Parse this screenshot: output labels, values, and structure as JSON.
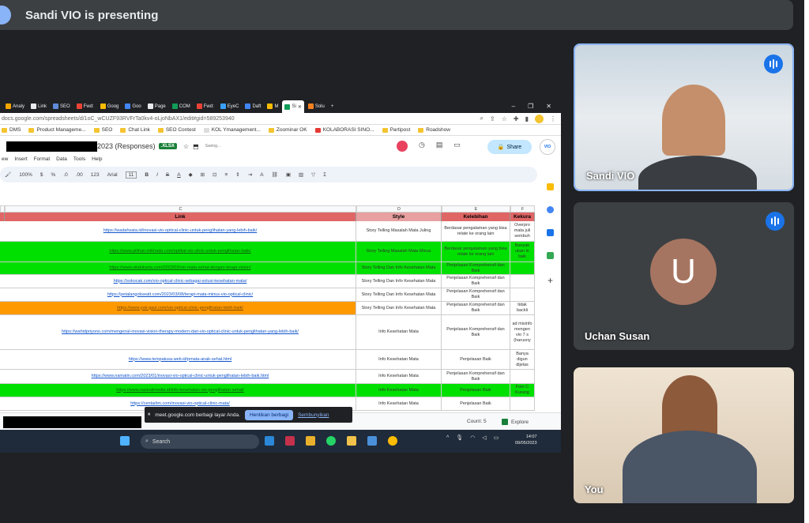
{
  "meet": {
    "presenter_text": "Sandi VIO is presenting",
    "participants": [
      {
        "name": "Sandi VIO",
        "speaking": true
      },
      {
        "name": "Uchan Susan",
        "initial": "U",
        "avatar_color": "#a67561",
        "speaking": true
      },
      {
        "name": "You"
      }
    ]
  },
  "browser": {
    "tabs": [
      "Analy",
      "Link",
      "SEO",
      "Fwd:",
      "Goog",
      "Goo",
      "Page",
      "COM",
      "Fwd:",
      "EyeC",
      "Daft",
      "M",
      "Si",
      "Solu"
    ],
    "url": "docs.google.com/spreadsheets/d/1oC_wCUZF93RVFrTa0kv4-oLjoNbAX1/edit#gid=589253940",
    "bookmarks": [
      "DMS",
      "Product Manageme...",
      "SEO",
      "Chat Link",
      "SEO Contest",
      "KOL Ymanagement...",
      "Zoominar OK",
      "KOLABORASI SINO...",
      "Partipost",
      "Roadshow"
    ]
  },
  "sheet": {
    "title_suffix": "2023 (Responses)",
    "badge": ".XLSX",
    "saving": "Saving...",
    "share_label": "Share",
    "vio": "VIO",
    "menus": [
      "Insert",
      "Format",
      "Data",
      "Tools",
      "Help"
    ],
    "toolbar": {
      "zoom": "100%",
      "currency": "$",
      "percent": "%",
      "dec1": ".0",
      "dec2": ".00",
      "fmt": "123",
      "font": "Arial",
      "size": "11"
    },
    "columns": [
      "C",
      "D",
      "E",
      "F"
    ],
    "headers": [
      "Link",
      "Style",
      "Kelebihan",
      "Kekura"
    ],
    "rows": [
      {
        "link": "https://wadahsata.id/inovasi-vio-optical-clinic-untuk-penglihatan-yang-lebih-baik/",
        "style": "Story Telling Masalah Mata Juling",
        "kelebihan": "Berdasar pengalaman yang bisa relate ke orang lain",
        "kekurangan": "Overpro mata juli sembuh"
      },
      {
        "link": "https://www.pilihan.mikhada.com/optikal-vio-clinic-untuk-penglihatan-baik/",
        "style": "Story Telling Masalah Mata Minus",
        "kelebihan": "Berdasar pengalaman yang bisa relate ke orang lain",
        "kekurangan": "Banyak ukan in baik"
      },
      {
        "link": "https://www.vitalokarta.com/2023/03/vio-mata-sehat-dengan-terapi-vision/",
        "style": "Story Telling Dan Info Kesehatan Mata",
        "kelebihan": "Penjelasan Komprehensif dan Baik",
        "kekurangan": ""
      },
      {
        "link": "https://sokocak.com/vio-optical-clinic-sebagai-solusi-kesehatan-mata/",
        "style": "Story Telling Dan Info Kesehatan Mata",
        "kelebihan": "Penjelasan Komprehensif dan Baik",
        "kekurangan": ""
      },
      {
        "link": "https://petalangokseatt.com/2023/03/08/terapi-mata-minus-vio-optical-clinic/",
        "style": "Story Telling Dan Info Kesehatan Mata",
        "kelebihan": "Penjelasan Komprehensif dan Baik",
        "kekurangan": ""
      },
      {
        "link": "https://www.yuk-gaul.com/vio-optical-clinic-penglihatan-lebih-baik/",
        "style": "Story Telling Dan Info Kesehatan Mata",
        "kelebihan": "Penjelasan Komprehensif dan Baik",
        "kekurangan": "tidak backli"
      },
      {
        "link": "https://wahidpriyono.com/mengenal-inovasi-vision-therapy-modern-dari-vio-optical-clinic-untuk-penglihatan-yang-lebih-baik/",
        "style": "Info Kesehatan Mata",
        "kelebihan": "Penjelasan Komprehensif dan Baik",
        "kekurangan": "ad misinfo mengen vio 7 s (harusny"
      },
      {
        "link": "https://www.tempatusa.web.id/pmata-anak-sehat.html",
        "style": "Info Kesehatan Mata",
        "kelebihan": "Penjelasan Baik",
        "kekurangan": "Banya digun dijelas"
      },
      {
        "link": "https://www.namatin.com/2023/01/inovasi-vio-optical-clinic-untuk-penglihatan-lebih-baik.html",
        "style": "Info Kesehatan Mata",
        "kelebihan": "Penjelasan Komprehensif dan Baik",
        "kekurangan": ""
      },
      {
        "link": "https://www.nasinalmedia.id/info-kesehatan-vio-penglihatan-sehat/",
        "style": "Info Kesehatan Mata",
        "kelebihan": "Penjelasan Baik",
        "kekurangan": "Foto C Kurang"
      },
      {
        "link": "https://centarlim.com/inovasi-vio-optical-clinic-mata/",
        "style": "Info Kesehatan Mata",
        "kelebihan": "Penjelasan Baik",
        "kekurangan": ""
      }
    ],
    "count": "Count: 5",
    "explore": "Explore"
  },
  "meetbar": {
    "text": "meet.google.com berbagi layar Anda.",
    "stop": "Hentikan berbagi",
    "hide": "Sembunyikan"
  },
  "taskbar": {
    "search": "Search",
    "time": "14:07",
    "date": "09/05/2023"
  }
}
